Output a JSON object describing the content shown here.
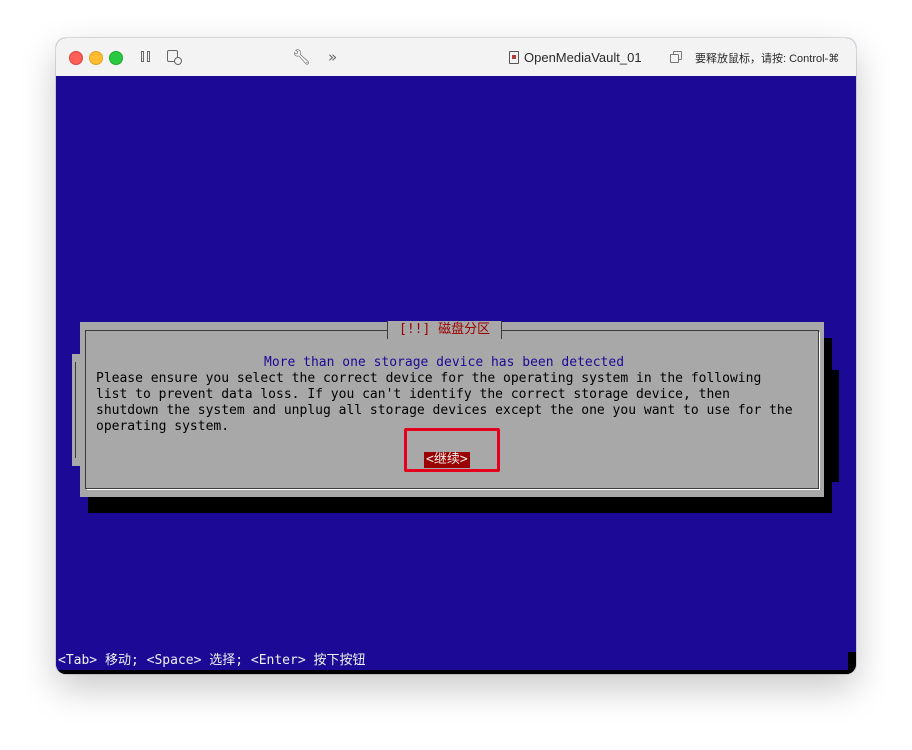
{
  "window": {
    "title": "OpenMediaVault_01",
    "release_hint": "要释放鼠标，请按: Control-⌘",
    "toolbar_icons": [
      "pause-icon",
      "snapshot-icon",
      "wrench-icon",
      "chevrons-icon",
      "document-icon",
      "copy-icon"
    ],
    "traffic_lights": {
      "close": "#fe5f57",
      "minimize": "#febc2e",
      "maximize": "#28c840"
    }
  },
  "screen": {
    "background": "#1c0a96",
    "dialog": {
      "title": "[!!] 磁盘分区",
      "headline": "More than one storage device has been detected",
      "body_lines": [
        "Please ensure you select the correct device for the operating system in the following",
        "list to prevent data loss. If you can't identify the correct storage device, then",
        "shutdown the system and unplug all storage devices except the one you want to use for the",
        "operating system."
      ],
      "continue_button": "<继续>",
      "colors": {
        "dialog_bg": "#a8a8a8",
        "title": "#9a0000",
        "button_bg": "#9a0000",
        "highlight": "#e4001c"
      }
    },
    "status_bar": "<Tab> 移动; <Space> 选择; <Enter> 按下按钮"
  }
}
